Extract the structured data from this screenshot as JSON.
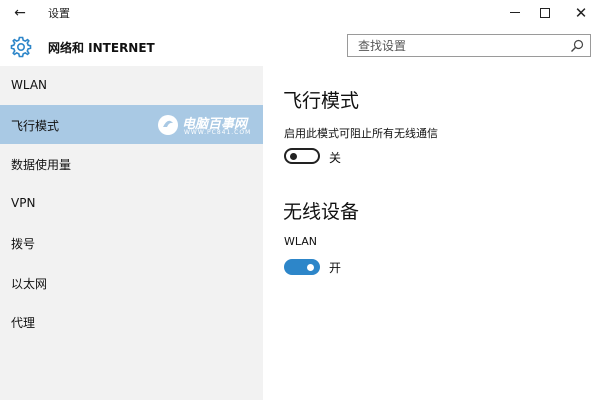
{
  "window": {
    "title": "设置",
    "back_icon": "←",
    "minimize_icon": "minimize-icon",
    "maximize_icon": "maximize-icon",
    "close_icon": "✕"
  },
  "header": {
    "icon": "gear-icon",
    "title": "网络和 INTERNET",
    "search_placeholder": "查找设置"
  },
  "sidebar": {
    "items": [
      {
        "label": "WLAN"
      },
      {
        "label": "飞行模式",
        "active": true
      },
      {
        "label": "数据使用量"
      },
      {
        "label": "VPN"
      },
      {
        "label": "拨号"
      },
      {
        "label": "以太网"
      },
      {
        "label": "代理"
      }
    ],
    "active_color": "#a9c9e4",
    "watermark": {
      "text": "电脑百事网",
      "sub": "WWW.PC841.COM"
    }
  },
  "main": {
    "airplane": {
      "heading": "飞行模式",
      "description": "启用此模式可阻止所有无线通信",
      "toggle_state": "关"
    },
    "wireless": {
      "heading": "无线设备",
      "device_label": "WLAN",
      "toggle_state": "开"
    },
    "accent_color": "#2d86c9"
  }
}
